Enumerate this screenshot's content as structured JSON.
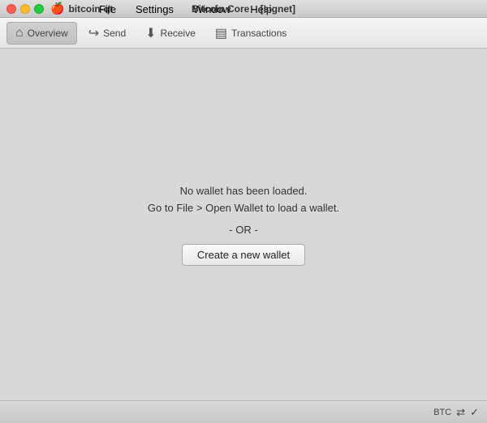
{
  "titlebar": {
    "app_name": "bitcoin-qt",
    "title": "Bitcoin Core – [signet]"
  },
  "menubar": {
    "items": [
      {
        "label": "File"
      },
      {
        "label": "Settings"
      },
      {
        "label": "Window"
      },
      {
        "label": "Help"
      }
    ]
  },
  "toolbar": {
    "buttons": [
      {
        "id": "overview",
        "label": "Overview",
        "active": true
      },
      {
        "id": "send",
        "label": "Send",
        "active": false
      },
      {
        "id": "receive",
        "label": "Receive",
        "active": false
      },
      {
        "id": "transactions",
        "label": "Transactions",
        "active": false
      }
    ]
  },
  "main": {
    "no_wallet_line1": "No wallet has been loaded.",
    "no_wallet_line2": "Go to File > Open Wallet to load a wallet.",
    "or_text": "- OR -",
    "create_wallet_label": "Create a new wallet"
  },
  "statusbar": {
    "currency": "BTC",
    "icons": [
      "network-icon",
      "sync-icon"
    ]
  }
}
